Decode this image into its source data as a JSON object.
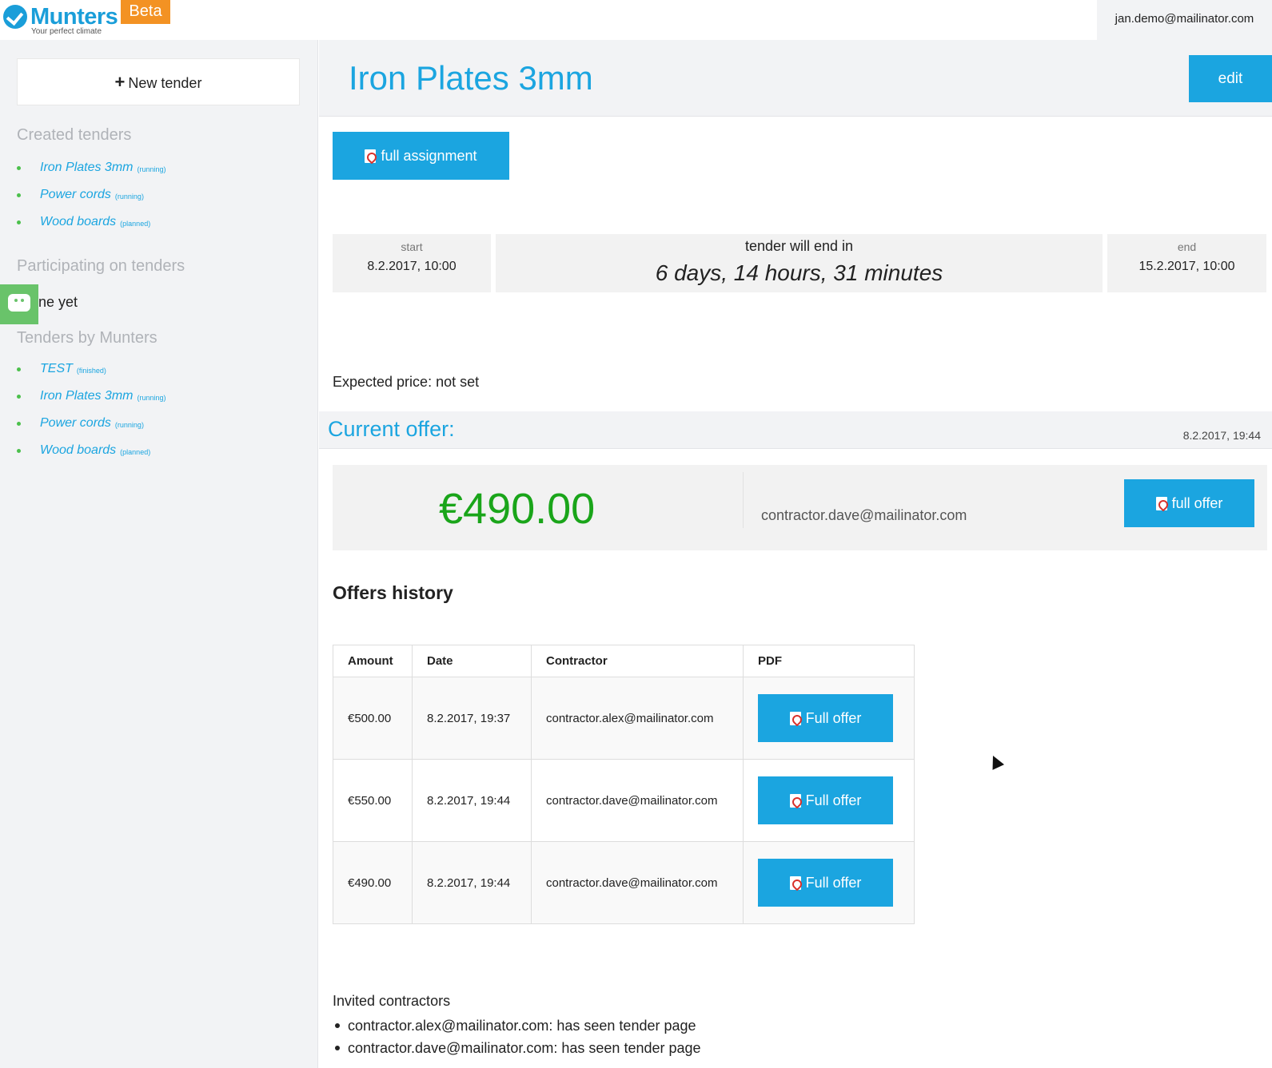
{
  "header": {
    "logo_text": "Munters",
    "logo_tagline": "Your perfect climate",
    "badge": "Beta",
    "user_email": "jan.demo@mailinator.com"
  },
  "sidebar": {
    "new_tender_label": "New tender",
    "created_heading": "Created tenders",
    "created": [
      {
        "name": "Iron Plates 3mm",
        "status": "(running)"
      },
      {
        "name": "Power cords",
        "status": "(running)"
      },
      {
        "name": "Wood boards",
        "status": "(planned)"
      }
    ],
    "participating_heading": "Participating on tenders",
    "participating_empty": "ne yet",
    "by_munters_heading": "Tenders by Munters",
    "by_munters": [
      {
        "name": "TEST",
        "status": "(finished)"
      },
      {
        "name": "Iron Plates 3mm",
        "status": "(running)"
      },
      {
        "name": "Power cords",
        "status": "(running)"
      },
      {
        "name": "Wood boards",
        "status": "(planned)"
      }
    ]
  },
  "main": {
    "title": "Iron Plates 3mm",
    "edit_label": "edit",
    "full_assignment_label": "full assignment",
    "timing": {
      "start_label": "start",
      "start_value": "8.2.2017, 10:00",
      "countdown_label": "tender will end in",
      "countdown_value": "6 days, 14 hours, 31 minutes",
      "end_label": "end",
      "end_value": "15.2.2017, 10:00"
    },
    "expected_price": "Expected price: not set",
    "current_offer": {
      "label": "Current offer:",
      "date": "8.2.2017, 19:44",
      "amount": "€490.00",
      "contractor": "contractor.dave@mailinator.com",
      "button_label": "full offer"
    },
    "history": {
      "title": "Offers history",
      "columns": [
        "Amount",
        "Date",
        "Contractor",
        "PDF"
      ],
      "rows": [
        {
          "amount": "€500.00",
          "date": "8.2.2017, 19:37",
          "contractor": "contractor.alex@mailinator.com",
          "pdf": "Full offer"
        },
        {
          "amount": "€550.00",
          "date": "8.2.2017, 19:44",
          "contractor": "contractor.dave@mailinator.com",
          "pdf": "Full offer"
        },
        {
          "amount": "€490.00",
          "date": "8.2.2017, 19:44",
          "contractor": "contractor.dave@mailinator.com",
          "pdf": "Full offer"
        }
      ]
    },
    "invited": {
      "title": "Invited contractors",
      "items": [
        "contractor.alex@mailinator.com: has seen tender page",
        "contractor.dave@mailinator.com: has seen tender page"
      ]
    }
  },
  "icons": {
    "logo": "munters-check-icon",
    "pdf": "pdf-icon",
    "chat": "chat-icon",
    "plus": "plus-icon",
    "cursor": "mouse-pointer-icon"
  },
  "colors": {
    "accent": "#1ba5e0",
    "beta": "#f39223",
    "price": "#1aa51a",
    "status_dot": "#4cc04c",
    "chat": "#69c36a"
  }
}
